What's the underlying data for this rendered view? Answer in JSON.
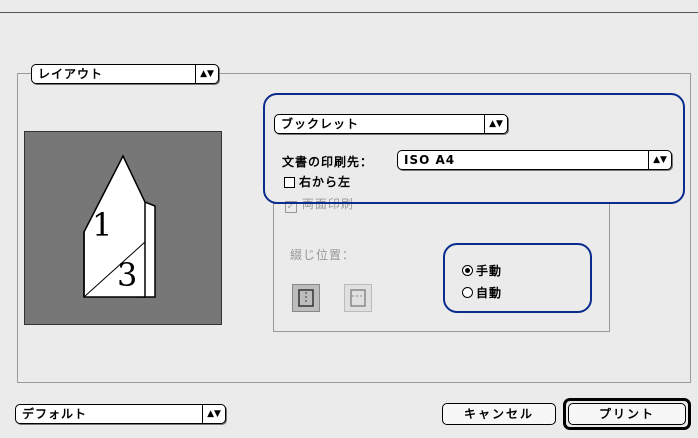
{
  "layout_menu": {
    "label": "レイアウト"
  },
  "booklet_menu": {
    "label": "ブックレット"
  },
  "print_dest": {
    "label": "文書の印刷先：",
    "value": "ISO A4"
  },
  "right_to_left": {
    "label": "右から左",
    "checked": false
  },
  "duplex": {
    "label": "両面印刷",
    "checked": true,
    "binding_label": "綴じ位置："
  },
  "duplex_mode": {
    "options": [
      "手動",
      "自動"
    ],
    "selected": "手動"
  },
  "preview": {
    "page_front": "1",
    "page_back": "3"
  },
  "presets": {
    "label": "デフォルト"
  },
  "buttons": {
    "cancel": "キャンセル",
    "print": "プリント"
  },
  "colors": {
    "highlight": "#0b2c8f",
    "preview_bg": "#777777"
  }
}
